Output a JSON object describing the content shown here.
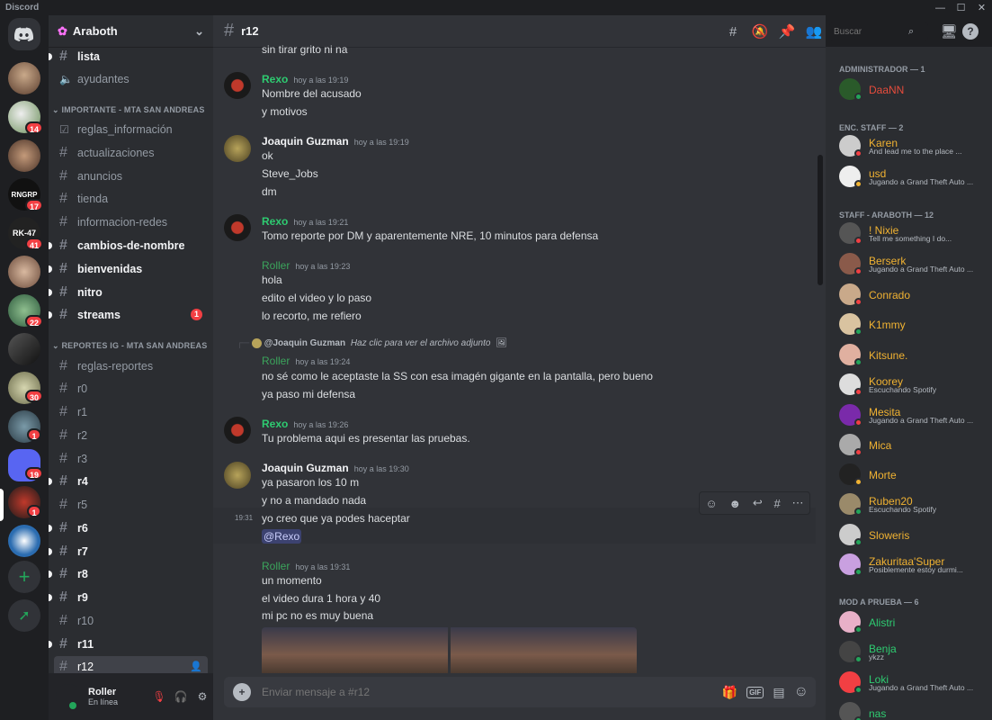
{
  "app": {
    "title": "Discord"
  },
  "server": {
    "name": "Araboth"
  },
  "channels": {
    "top": [
      {
        "name": "lista",
        "unread": true
      },
      {
        "name": "ayudantes",
        "voice": true
      }
    ],
    "cat1": "IMPORTANTE - MTA SAN ANDREAS",
    "list1": [
      "reglas_información",
      "actualizaciones",
      "anuncios",
      "tienda",
      "informacion-redes",
      "cambios-de-nombre",
      "bienvenidas",
      "nitro",
      "streams"
    ],
    "streams_badge": "1",
    "cat2": "REPORTES IG - MTA SAN ANDREAS",
    "list2": [
      "reglas-reportes",
      "r0",
      "r1",
      "r2",
      "r3",
      "r4",
      "r5",
      "r6",
      "r7",
      "r8",
      "r9",
      "r10",
      "r11",
      "r12"
    ]
  },
  "guild_badges": [
    "14",
    "17",
    "41",
    "22",
    "30",
    "1",
    "19",
    "1"
  ],
  "user": {
    "name": "Roller",
    "status": "En línea"
  },
  "channel": {
    "name": "r12"
  },
  "search": {
    "placeholder": "Buscar"
  },
  "composer": {
    "placeholder": "Enviar mensaje a #r12",
    "gif": "GIF"
  },
  "messages": {
    "top_line": "sin tirar grito ni na",
    "m1": {
      "author": "Rexo",
      "time": "hoy a las 19:19",
      "lines": [
        "Nombre del acusado",
        "y motivos"
      ]
    },
    "m2": {
      "author": "Joaquin Guzman",
      "time": "hoy a las 19:19",
      "lines": [
        "ok",
        "Steve_Jobs",
        "dm"
      ]
    },
    "m3": {
      "author": "Rexo",
      "time": "hoy a las 19:21",
      "lines": [
        "Tomo reporte por DM y aparentemente NRE, 10 minutos para defensa"
      ]
    },
    "m4": {
      "author": "Roller",
      "time": "hoy a las 19:23",
      "lines": [
        "hola",
        "edito el video y lo paso",
        "lo recorto, me refiero"
      ]
    },
    "m5": {
      "reply_author": "@Joaquin Guzman",
      "reply_text": "Haz clic para ver el archivo adjunto",
      "author": "Roller",
      "time": "hoy a las 19:24",
      "lines": [
        "no sé como le aceptaste la SS con esa imagén gigante en la pantalla, pero bueno",
        "ya paso mi defensa"
      ]
    },
    "m6": {
      "author": "Rexo",
      "time": "hoy a las 19:26",
      "lines": [
        "Tu problema aqui es presentar las pruebas."
      ]
    },
    "m7": {
      "author": "Joaquin Guzman",
      "time": "hoy a las 19:30",
      "lines": [
        "ya pasaron los 10 m",
        "y no a mandado nada",
        "yo creo que ya podes haceptar",
        "@Rexo"
      ],
      "hover_time": "19:31"
    },
    "m8": {
      "author": "Roller",
      "time": "hoy a las 19:31",
      "lines": [
        "un momento",
        "el video dura 1 hora y 40",
        "mi pc no es muy buena"
      ]
    }
  },
  "members": {
    "cats": [
      "ADMINISTRADOR — 1",
      "ENC. STAFF — 2",
      "STAFF - ARABOTH — 12",
      "MOD A PRUEBA — 6"
    ],
    "list": [
      {
        "name": "DaaNN",
        "color": "#e74c3c",
        "status": "online"
      },
      {
        "name": "Karen",
        "color": "#f0b232",
        "act": "And lead me to the place ...",
        "status": "dnd"
      },
      {
        "name": "usd",
        "color": "#f0b232",
        "act": "Jugando a Grand Theft Auto ...",
        "status": "idle"
      },
      {
        "name": "! Nixie",
        "color": "#f0b232",
        "act": "Tell me something I do...",
        "status": "dnd"
      },
      {
        "name": "Berserk",
        "color": "#f0b232",
        "act": "Jugando a Grand Theft Auto ...",
        "status": "dnd"
      },
      {
        "name": "Conrado",
        "color": "#f0b232",
        "status": "dnd"
      },
      {
        "name": "K1mmy",
        "color": "#f0b232",
        "status": "online"
      },
      {
        "name": "Kitsune.",
        "color": "#f0b232",
        "status": "online"
      },
      {
        "name": "Koorey",
        "color": "#f0b232",
        "act": "Escuchando Spotify",
        "status": "dnd"
      },
      {
        "name": "Mesita",
        "color": "#f0b232",
        "act": "Jugando a Grand Theft Auto ...",
        "status": "dnd"
      },
      {
        "name": "Mica",
        "color": "#f0b232",
        "status": "dnd"
      },
      {
        "name": "Morte",
        "color": "#f0b232",
        "status": "idle"
      },
      {
        "name": "Ruben20",
        "color": "#f0b232",
        "act": "Escuchando Spotify",
        "status": "online"
      },
      {
        "name": "Sloweris",
        "color": "#f0b232",
        "status": "online"
      },
      {
        "name": "Zakuritaa'Super",
        "color": "#f0b232",
        "act": "Posiblemente estoy durmi...",
        "status": "online"
      },
      {
        "name": "Alistri",
        "color": "#2ecc71",
        "status": "online"
      },
      {
        "name": "Benja",
        "color": "#2ecc71",
        "act": "ykzz",
        "status": "online"
      },
      {
        "name": "Loki",
        "color": "#2ecc71",
        "act": "Jugando a Grand Theft Auto ...",
        "status": "online"
      },
      {
        "name": "nas",
        "color": "#2ecc71",
        "status": "online"
      }
    ]
  },
  "colors": {
    "rexo": "#2ecc71",
    "joaquin": "#f2f3f5",
    "roller": "#3ba55c",
    "mention_bg": "#3c4270",
    "mention_fg": "#c9cdfb"
  }
}
